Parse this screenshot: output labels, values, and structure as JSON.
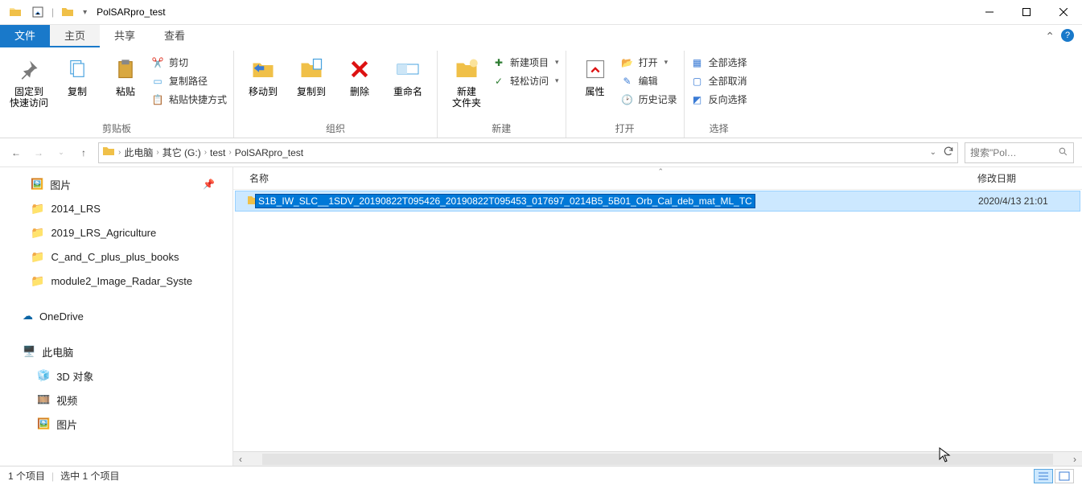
{
  "title": "PolSARpro_test",
  "tabs": {
    "file": "文件",
    "home": "主页",
    "share": "共享",
    "view": "查看"
  },
  "ribbon": {
    "pin_quick": "固定到\n快速访问",
    "copy": "复制",
    "paste": "粘贴",
    "cut": "剪切",
    "copy_path": "复制路径",
    "paste_shortcut": "粘贴快捷方式",
    "clipboard": "剪贴板",
    "move_to": "移动到",
    "copy_to": "复制到",
    "delete": "删除",
    "rename": "重命名",
    "organize": "组织",
    "new_folder": "新建\n文件夹",
    "new_item": "新建项目",
    "easy_access": "轻松访问",
    "new": "新建",
    "properties": "属性",
    "open_btn": "打开",
    "edit": "编辑",
    "history": "历史记录",
    "open_group": "打开",
    "select_all": "全部选择",
    "select_none": "全部取消",
    "invert": "反向选择",
    "select": "选择"
  },
  "breadcrumb": {
    "this_pc": "此电脑",
    "drive": "其它 (G:)",
    "test": "test",
    "current": "PolSARpro_test"
  },
  "search_placeholder": "搜索\"Pol…",
  "nav": {
    "pictures": "图片",
    "f1": "2014_LRS",
    "f2": "2019_LRS_Agriculture",
    "f3": "C_and_C_plus_plus_books",
    "f4": "module2_Image_Radar_Syste",
    "onedrive": "OneDrive",
    "this_pc": "此电脑",
    "objects3d": "3D 对象",
    "videos": "视频",
    "pictures2": "图片"
  },
  "columns": {
    "name": "名称",
    "date": "修改日期"
  },
  "files": [
    {
      "name": "S1B_IW_SLC__1SDV_20190822T095426_20190822T095453_017697_0214B5_5B01_Orb_Cal_deb_mat_ML_TC",
      "date": "2020/4/13 21:01"
    }
  ],
  "status": {
    "count": "1 个项目",
    "selected": "选中 1 个项目"
  }
}
